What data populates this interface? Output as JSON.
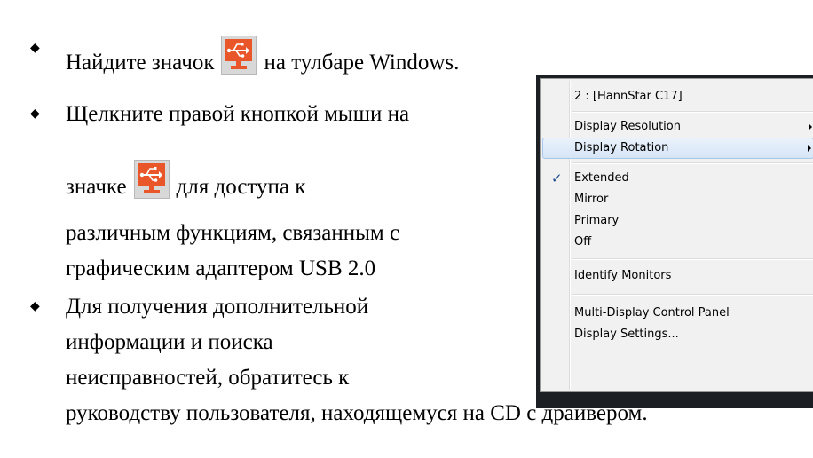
{
  "instructions": {
    "line1_before": "Найдите значок",
    "line1_after": "на тулбаре Windows.",
    "line2": "Щелкните правой кнопкой мыши на",
    "line3_before": "значке",
    "line3_after": "для доступа к",
    "line4": "различным функциям, связанным с",
    "line5": "графическим адаптером USB 2.0",
    "line6": "Для получения дополнительной",
    "line7": "информации и поиска",
    "line8": "неисправностей, обратитесь к",
    "line9": "руководству пользователя, находящемуся на CD с драйвером."
  },
  "icon": {
    "name": "usb-display-icon",
    "color": "#e8562a"
  },
  "context_menu": {
    "header": "2 : [HannStar C17]",
    "display_resolution": "Display Resolution",
    "display_rotation": "Display Rotation",
    "extended": "Extended",
    "extended_checked": true,
    "mirror": "Mirror",
    "primary": "Primary",
    "off": "Off",
    "identify_monitors": "Identify Monitors",
    "multi_display_control_panel": "Multi-Display Control Panel",
    "display_settings": "Display Settings..."
  }
}
